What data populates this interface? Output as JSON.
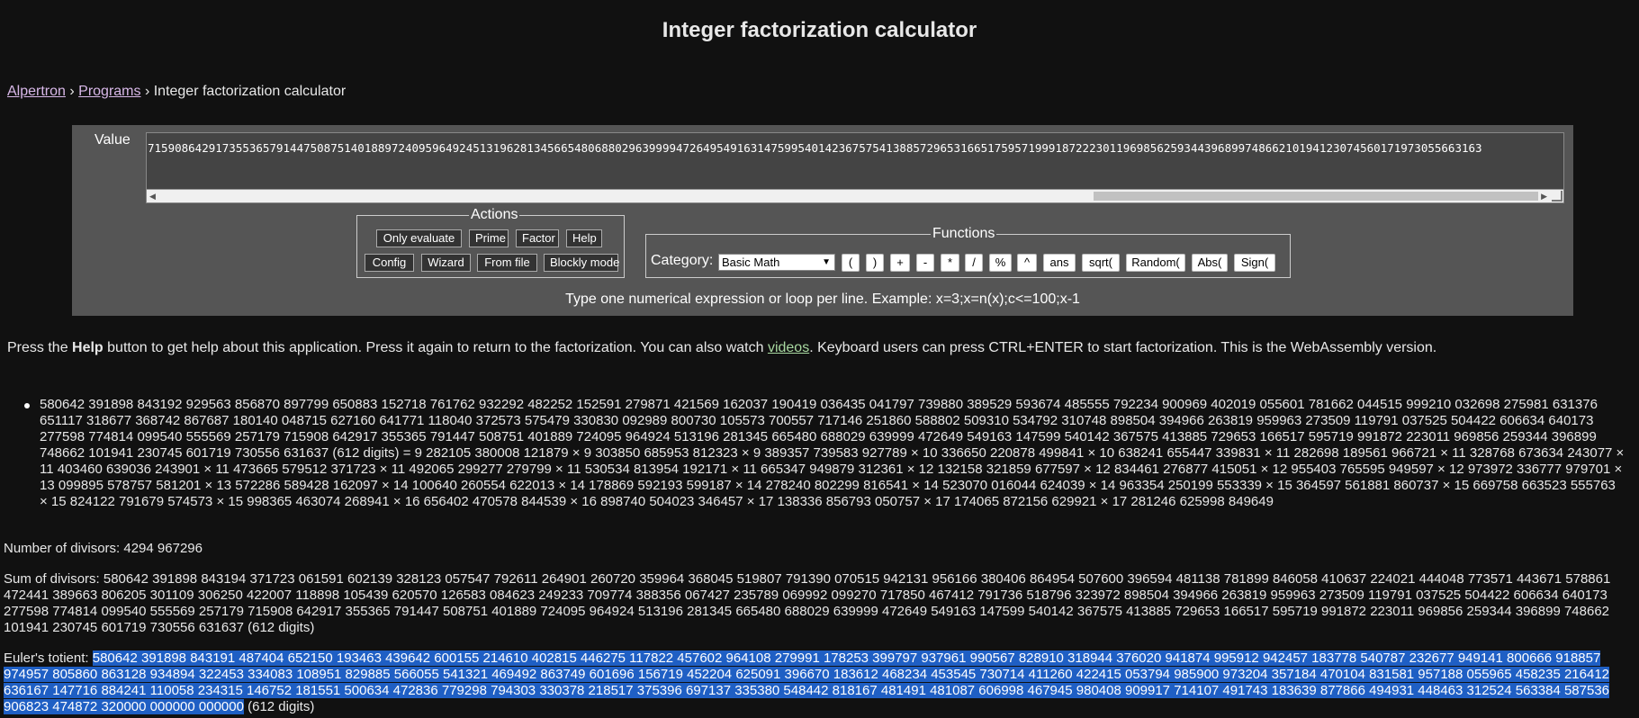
{
  "title": "Integer factorization calculator",
  "breadcrumb": {
    "home": "Alpertron",
    "sep1": " › ",
    "programs": "Programs",
    "sep2": " › ",
    "current": "Integer factorization calculator"
  },
  "input": {
    "label": "Value",
    "value": "71590864291735536579144750875140188972409596492451319628134566548068802963999947264954916314759954014236757541388572965316651759571999187222301196985625934439689974866210194123074560171973055663163"
  },
  "actions": {
    "legend": "Actions",
    "only_evaluate": "Only evaluate",
    "prime": "Prime",
    "factor": "Factor",
    "help": "Help",
    "config": "Config",
    "wizard": "Wizard",
    "from_file": "From file",
    "blockly": "Blockly mode"
  },
  "functions": {
    "legend": "Functions",
    "category_label": "Category:",
    "category_value": "Basic Math",
    "buttons": [
      "(",
      ")",
      "+",
      "-",
      "*",
      "/",
      "%",
      "^",
      "ans",
      "sqrt(",
      "Random(",
      "Abs(",
      "Sign("
    ]
  },
  "hint": "Type one numerical expression or loop per line. Example: x=3;x=n(x);c<=100;x-1",
  "help_text": {
    "p1": "Press the ",
    "help_word": "Help",
    "p2": " button to get help about this application. Press it again to return to the factorization. You can also watch ",
    "videos": "videos",
    "p3": ". Keyboard users can press CTRL+ENTER to start factorization. This is the WebAssembly version."
  },
  "results": {
    "factorization": "580642 391898 843192 929563 856870 897799 650883 152718 761762 932292 482252 152591 279871 421569 162037 190419 036435 041797 739880 389529 593674 485555 792234 900969 402019 055601 781662 044515 999210 032698 275981 631376 651117 318677 368742 867687 180140 048715 627160 641771 118040 372573 575479 330830 092989 800730 105573 700557 717146 251860 588802 509310 534792 310748 898504 394966 263819 959963 273509 119791 037525 504422 606634 640173 277598 774814 099540 555569 257179 715908 642917 355365 791447 508751 401889 724095 964924 513196 281345 665480 688029 639999 472649 549163 147599 540142 367575 413885 729653 166517 595719 991872 223011 969856 259344 396899 748662 101941 230745 601719 730556 631637 (612 digits) = 9 282105 380008 121879 × 9 303850 685953 812323 × 9 389357 739583 927789 × 10 336650 220878 499841 × 10 638241 655447 339831 × 11 282698 189561 966721 × 11 328768 673634 243077 × 11 403460 639036 243901 × 11 473665 579512 371723 × 11 492065 299277 279799 × 11 530534 813954 192171 × 11 665347 949879 312361 × 12 132158 321859 677597 × 12 834461 276877 415051 × 12 955403 765595 949597 × 12 973972 336777 979701 × 13 099895 578757 581201 × 13 572286 589428 162097 × 14 100640 260554 622013 × 14 178869 592193 599187 × 14 278240 802299 816541 × 14 523070 016044 624039 × 14 963354 250199 553339 × 15 364597 561881 860737 × 15 669758 663523 555763 × 15 824122 791679 574573 × 15 998365 463074 268941 × 16 656402 470578 844539 × 16 898740 504023 346457 × 17 138336 856793 050757 × 17 174065 872156 629921 × 17 281246 625998 849649",
    "divisors_label": "Number of divisors: ",
    "divisors_value": "4294 967296",
    "sum_label": "Sum of divisors: ",
    "sum_value": "580642 391898 843194 371723 061591 602139 328123 057547 792611 264901 260720 359964 368045 519807 791390 070515 942131 956166 380406 864954 507600 396594 481138 781899 846058 410637 224021 444048 773571 443671 578861 472441 389663 806205 301109 306250 422007 118898 105439 620570 126583 084623 249233 709774 388356 067427 235789 069992 099270 717850 467412 791736 518796 323972 898504 394966 263819 959963 273509 119791 037525 504422 606634 640173 277598 774814 099540 555569 257179 715908 642917 355365 791447 508751 401889 724095 964924 513196 281345 665480 688029 639999 472649 549163 147599 540142 367575 413885 729653 166517 595719 991872 223011 969856 259344 396899 748662 101941 230745 601719 730556 631637 (612 digits)",
    "sum_digits": "",
    "totient_label": "Euler's totient: ",
    "totient_value": "580642 391898 843191 487404 652150 193463 439642 600155 214610 402815 446275 117822 457602 964108 279991 178253 399797 937961 990567 828910 318944 376020 941874 995912 942457 183778 540787 232677 949141 800666 918857 974957 805860 863128 934894 322453 334083 108951 829885 566055 541321 469492 863749 601696 156719 452204 625091 396670 183612 468234 453545 730714 411260 422415 053794 985900 973204 357184 470104 831581 957188 055965 458235 216412 636167 147716 884241 110058 234315 146752 181551 500634 472836 779298 794303 330378 218517 375396 697137 335380 548442 818167 481491 481087 606998 467945 980408 909917 714107 491743 183639 877866 494931 448463 312524 563384 587536 906823 474872 320000 000000 000000",
    "totient_digits": " (612 digits)"
  },
  "colors": {
    "background": "#111111",
    "panel": "#555555",
    "selection": "#1f5fc4",
    "link": "#d8b8e8",
    "video_link": "#a8d8a0"
  }
}
